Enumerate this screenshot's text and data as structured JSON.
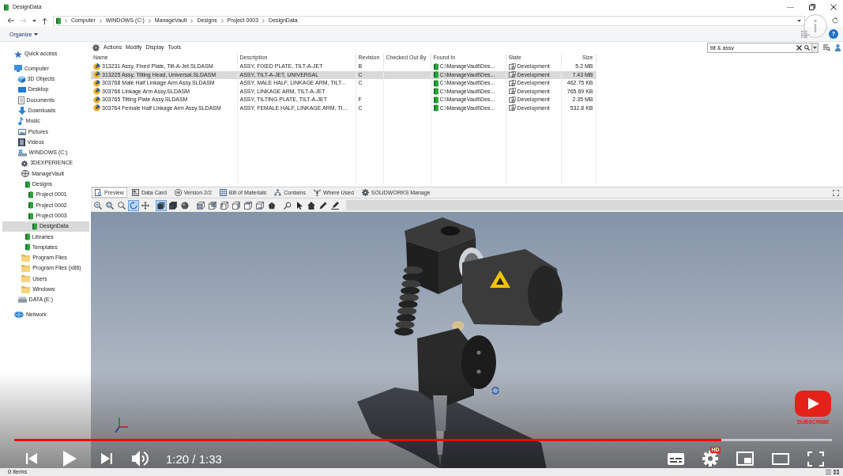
{
  "window": {
    "title": "DesignData"
  },
  "address_bar": {
    "path": [
      "Computer",
      "WINDOWS (C:)",
      "ManageVault",
      "Designs",
      "Project 0003",
      "DesignData"
    ]
  },
  "command_bar": {
    "organize": "Organize",
    "help": "?"
  },
  "sidebar": {
    "items": [
      {
        "label": "Quick access",
        "kind": "star",
        "selected": false
      },
      {
        "label": "Computer",
        "kind": "computer",
        "selected": false,
        "children": [
          {
            "label": "3D Objects",
            "kind": "cube",
            "selected": false
          },
          {
            "label": "Desktop",
            "kind": "desktop",
            "selected": false
          },
          {
            "label": "Documents",
            "kind": "document",
            "selected": false
          },
          {
            "label": "Downloads",
            "kind": "download",
            "selected": false
          },
          {
            "label": "Music",
            "kind": "music",
            "selected": false
          },
          {
            "label": "Pictures",
            "kind": "pictures",
            "selected": false
          },
          {
            "label": "Videos",
            "kind": "video",
            "selected": false
          },
          {
            "label": "WINDOWS (C:)",
            "kind": "system-drive",
            "selected": false,
            "children": [
              {
                "label": "3DEXPERIENCE",
                "kind": "gear",
                "selected": false
              },
              {
                "label": "ManageVault",
                "kind": "vault",
                "selected": false,
                "children": [
                  {
                    "label": "Designs",
                    "kind": "vault-folder",
                    "selected": false,
                    "children": [
                      {
                        "label": "Project 0001",
                        "kind": "vault-folder",
                        "selected": false
                      },
                      {
                        "label": "Project 0002",
                        "kind": "vault-folder",
                        "selected": false
                      },
                      {
                        "label": "Project 0003",
                        "kind": "vault-folder",
                        "selected": false,
                        "children": [
                          {
                            "label": "DesignData",
                            "kind": "vault-folder",
                            "selected": true
                          }
                        ]
                      }
                    ]
                  },
                  {
                    "label": "Libraries",
                    "kind": "vault-folder",
                    "selected": false
                  },
                  {
                    "label": "Templates",
                    "kind": "vault-folder",
                    "selected": false
                  }
                ]
              },
              {
                "label": "Program Files",
                "kind": "folder",
                "selected": false
              },
              {
                "label": "Program Files (x86)",
                "kind": "folder",
                "selected": false
              },
              {
                "label": "Users",
                "kind": "folder",
                "selected": false
              },
              {
                "label": "Windows",
                "kind": "folder",
                "selected": false
              }
            ]
          },
          {
            "label": "DATA (E:)",
            "kind": "drive",
            "selected": false
          }
        ]
      },
      {
        "label": "Network",
        "kind": "network",
        "selected": false
      }
    ]
  },
  "menu": [
    "Actions",
    "Modify",
    "Display",
    "Tools"
  ],
  "search": {
    "value": "tilt & assy"
  },
  "table": {
    "columns": [
      "Name",
      "Description",
      "Revision",
      "Checked Out By",
      "Found In",
      "State",
      "Size"
    ],
    "rows": [
      {
        "name": "313231 Assy, Fixed Plate, Tilt-A-Jet.SLDASM",
        "description": "ASSY, FIXED PLATE, TILT-A-JET",
        "revision": "B",
        "found_in": "C:\\ManageVault\\Des...",
        "state": "Development",
        "size": "5.2 MB",
        "selected": false
      },
      {
        "name": "313225 Assy, Tilting Head, Universal.SLDASM",
        "description": "ASSY, TILT-A-JET, UNIVERSAL",
        "revision": "C",
        "found_in": "C:\\ManageVault\\Des...",
        "state": "Development",
        "size": "7.43 MB",
        "selected": true
      },
      {
        "name": "303768 Male Half Linkage Arm Assy.SLDASM",
        "description": "ASSY, MALE HALF, LINKAGE ARM, TILT...",
        "revision": "C",
        "found_in": "C:\\ManageVault\\Des...",
        "state": "Development",
        "size": "462.75 KB",
        "selected": false
      },
      {
        "name": "303766 Linkage Arm Assy.SLDASM",
        "description": "ASSY, LINKAGE ARM, TILT-A-JET",
        "found_in": "C:\\ManageVault\\Des...",
        "state": "Development",
        "size": "765.69 KB",
        "selected": false
      },
      {
        "name": "303765 Tilting Plate Assy.SLDASM",
        "description": "ASSY, TILTING PLATE, TILT-A-JET",
        "revision": "F",
        "found_in": "C:\\ManageVault\\Des...",
        "state": "Development",
        "size": "2.35 MB",
        "selected": false
      },
      {
        "name": "303764 Female Half Linkage Arm Assy.SLDASM",
        "description": "ASSY, FEMALE HALF, LINKAGE ARM, TI...",
        "revision": "C",
        "found_in": "C:\\ManageVault\\Des...",
        "state": "Development",
        "size": "532.8 KB",
        "selected": false
      }
    ]
  },
  "preview_tabs": [
    {
      "label": "Preview",
      "selected": true
    },
    {
      "label": "Data Card",
      "selected": false
    },
    {
      "label": "Version 2/2",
      "selected": false
    },
    {
      "label": "Bill of Materials",
      "selected": false
    },
    {
      "label": "Contains",
      "selected": false
    },
    {
      "label": "Where Used",
      "selected": false
    },
    {
      "label": "SOLIDWORKS Manage",
      "selected": false
    }
  ],
  "viewer_toolbar": {
    "groups": [
      [
        {
          "kind": "zoom-in",
          "selected": false
        },
        {
          "kind": "zoom-area",
          "selected": false
        },
        {
          "kind": "zoom",
          "selected": false
        },
        {
          "kind": "rotate",
          "selected": true
        },
        {
          "kind": "pan",
          "selected": false
        }
      ],
      [
        {
          "kind": "shaded",
          "selected": true
        },
        {
          "kind": "shaded-edges",
          "selected": false
        },
        {
          "kind": "sphere",
          "selected": false
        }
      ],
      [
        {
          "kind": "view-front",
          "selected": false
        },
        {
          "kind": "view-back",
          "selected": false
        },
        {
          "kind": "view-left",
          "selected": false
        },
        {
          "kind": "view-right",
          "selected": false
        },
        {
          "kind": "view-top",
          "selected": false
        },
        {
          "kind": "view-bottom",
          "selected": false
        },
        {
          "kind": "render",
          "selected": false
        }
      ],
      [
        {
          "kind": "measure",
          "selected": false
        },
        {
          "kind": "select",
          "selected": false
        },
        {
          "kind": "home",
          "selected": false
        },
        {
          "kind": "pencil",
          "selected": false
        },
        {
          "kind": "markup",
          "selected": false
        }
      ]
    ]
  },
  "status_bar": {
    "text": "0 items"
  },
  "video_player": {
    "progress": {
      "level": 0.865
    },
    "time": "1:20 / 1:33",
    "quality_badge": "HD",
    "subscribe_label": "SUBSCRIBE"
  }
}
